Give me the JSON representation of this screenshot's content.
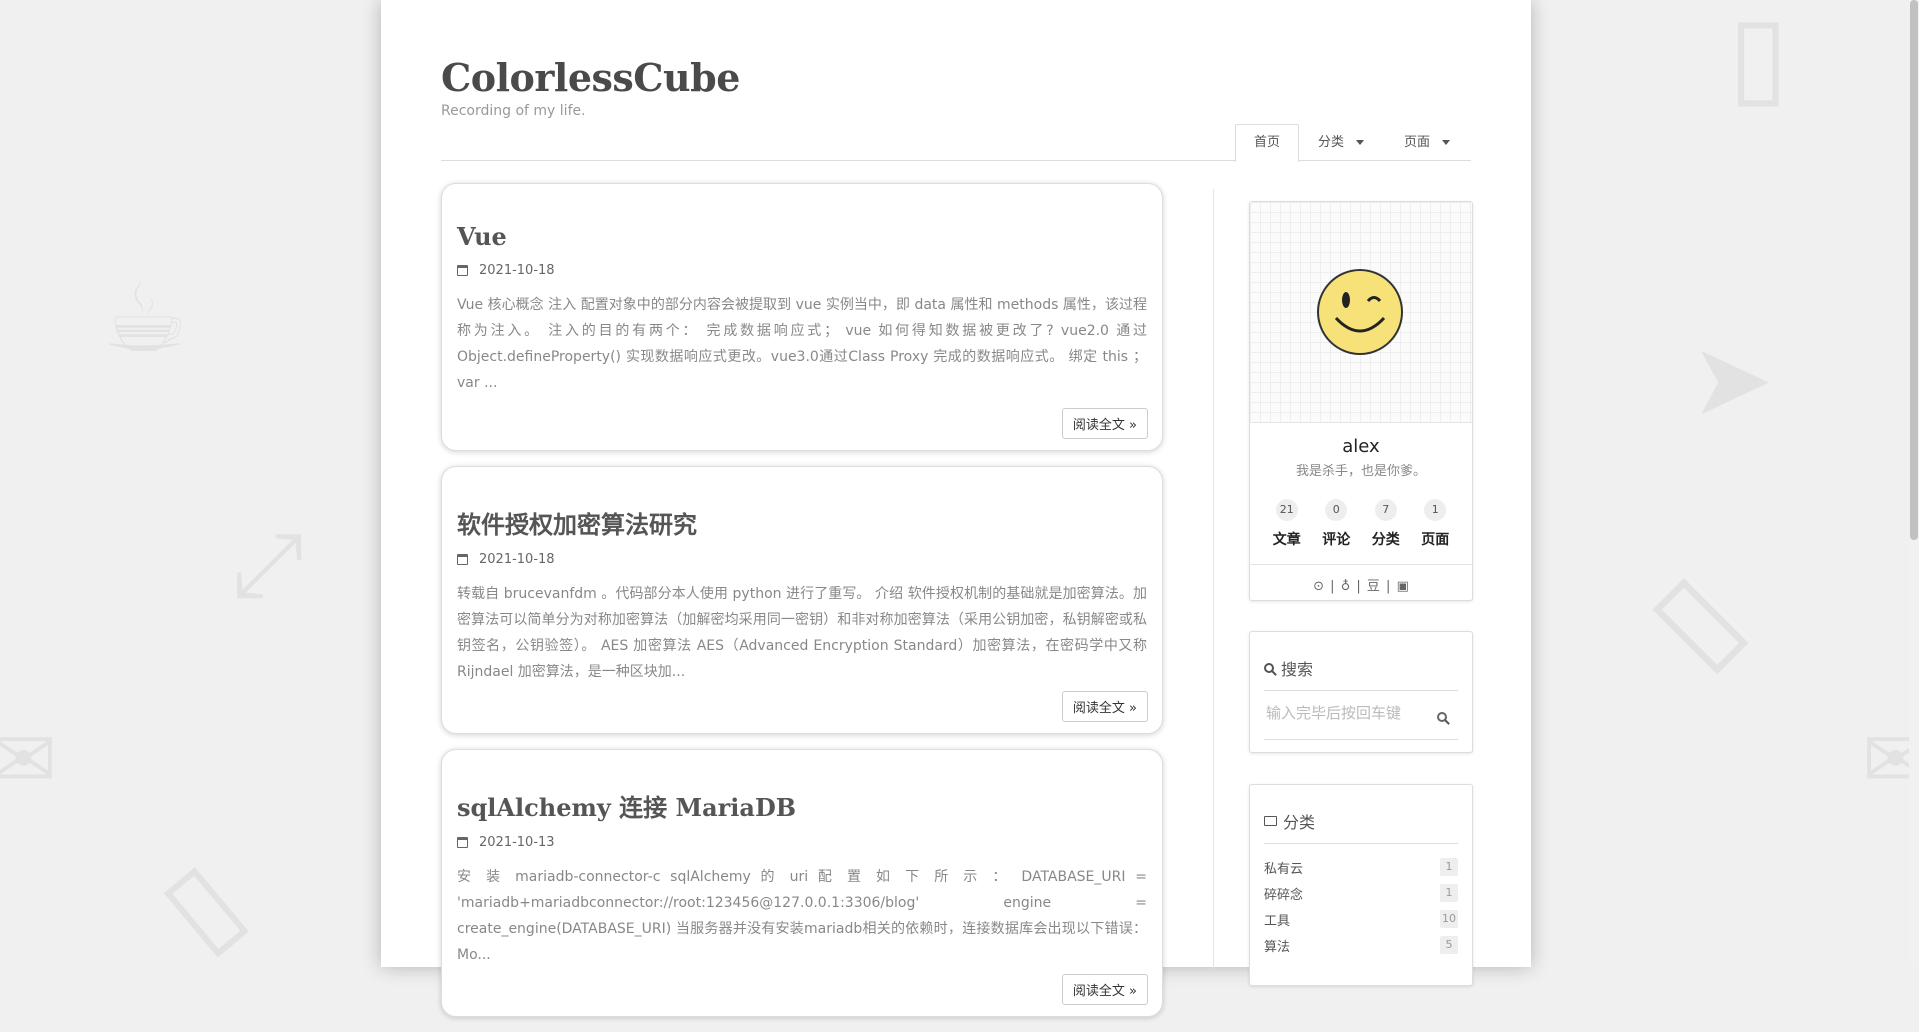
{
  "site": {
    "title": "ColorlessCube",
    "subtitle": "Recording of my life."
  },
  "nav": {
    "items": [
      {
        "label": "首页",
        "active": true
      },
      {
        "label": "分类",
        "dropdown": true
      },
      {
        "label": "页面",
        "dropdown": true
      }
    ]
  },
  "posts": [
    {
      "title": "Vue",
      "date": "2021-10-18",
      "excerpt": "Vue 核心概念 注入 配置对象中的部分内容会被提取到 vue 实例当中，即 data 属性和 methods 属性，该过程称为注入。 注入的目的有两个： 完成数据响应式； vue 如何得知数据被更改了? vue2.0 通过 Object.defineProperty() 实现数据响应式更改。vue3.0通过Class Proxy 完成的数据响应式。 绑定 this ； var ...",
      "read_more": "阅读全文 »"
    },
    {
      "title": "软件授权加密算法研究",
      "date": "2021-10-18",
      "excerpt": "转载自 brucevanfdm 。代码部分本人使用 python 进行了重写。 介绍 软件授权机制的基础就是加密算法。加密算法可以简单分为对称加密算法（加解密均采用同一密钥）和非对称加密算法（采用公钥加密，私钥解密或私钥签名，公钥验签）。 AES 加密算法 AES（Advanced Encryption Standard）加密算法，在密码学中又称 Rijndael 加密算法，是一种区块加...",
      "read_more": "阅读全文 »"
    },
    {
      "title": "sqlAlchemy 连接 MariaDB",
      "date": "2021-10-13",
      "excerpt": "安 装 mariadb-connector-c sqlAlchemy 的 uri 配 置 如 下 所 示 ： DATABASE_URI = 'mariadb+mariadbconnector://root:123456@127.0.0.1:3306/blog' engine = create_engine(DATABASE_URI) 当服务器并没有安装mariadb相关的依赖时，连接数据库会出现以下错误： Mo...",
      "read_more": "阅读全文 »"
    }
  ],
  "profile": {
    "name": "alex",
    "motto": "我是杀手，也是你爹。",
    "stats": [
      {
        "num": "21",
        "label": "文章"
      },
      {
        "num": "0",
        "label": "评论"
      },
      {
        "num": "7",
        "label": "分类"
      },
      {
        "num": "1",
        "label": "页面"
      }
    ],
    "social_icons": [
      "github-icon",
      "weibo-icon",
      "douban-icon",
      "bilibili-icon"
    ],
    "douban_text": "豆"
  },
  "search": {
    "title": "搜索",
    "placeholder": "输入完毕后按回车键"
  },
  "categories": {
    "title": "分类",
    "items": [
      {
        "name": "私有云",
        "count": "1"
      },
      {
        "name": "碎碎念",
        "count": "1"
      },
      {
        "name": "工具",
        "count": "10"
      },
      {
        "name": "算法",
        "count": "5"
      }
    ]
  },
  "colors": {
    "background": "#f0f0f0",
    "title": "#4a4a4a",
    "smiley": "#f7e27a"
  }
}
